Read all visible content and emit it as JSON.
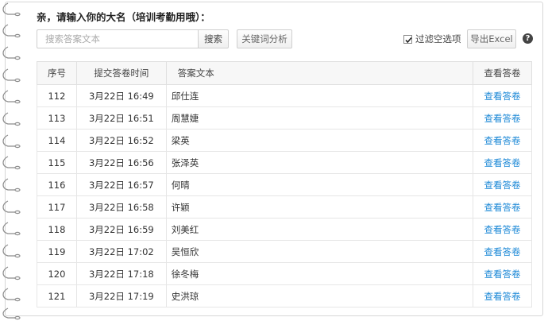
{
  "question_title": "亲，请输入你的大名（培训考勤用哦）：",
  "toolbar": {
    "search_placeholder": "搜索答案文本",
    "search_label": "搜索",
    "keyword_label": "关键词分析",
    "filter_label": "过滤空选项",
    "filter_checked": true,
    "export_label": "导出Excel",
    "help_symbol": "?"
  },
  "table": {
    "headers": {
      "id": "序号",
      "time": "提交答卷时间",
      "text": "答案文本",
      "action": "查看答卷"
    },
    "rows": [
      {
        "id": "112",
        "time": "3月22日 16:49",
        "text": "邱仕连",
        "action": "查看答卷"
      },
      {
        "id": "113",
        "time": "3月22日 16:51",
        "text": "周慧婕",
        "action": "查看答卷"
      },
      {
        "id": "114",
        "time": "3月22日 16:52",
        "text": "梁英",
        "action": "查看答卷"
      },
      {
        "id": "115",
        "time": "3月22日 16:56",
        "text": "张泽英",
        "action": "查看答卷"
      },
      {
        "id": "116",
        "time": "3月22日 16:57",
        "text": "何晴",
        "action": "查看答卷"
      },
      {
        "id": "117",
        "time": "3月22日 16:58",
        "text": "许颖",
        "action": "查看答卷"
      },
      {
        "id": "118",
        "time": "3月22日 16:59",
        "text": "刘美红",
        "action": "查看答卷"
      },
      {
        "id": "119",
        "time": "3月22日 17:02",
        "text": "吴恒欣",
        "action": "查看答卷"
      },
      {
        "id": "120",
        "time": "3月22日 17:18",
        "text": "徐冬梅",
        "action": "查看答卷"
      },
      {
        "id": "121",
        "time": "3月22日 17:19",
        "text": "史洪琼",
        "action": "查看答卷"
      }
    ]
  },
  "colors": {
    "link": "#1a87d6",
    "header_bg": "#f7f7f7",
    "border": "#e0e0e0"
  }
}
